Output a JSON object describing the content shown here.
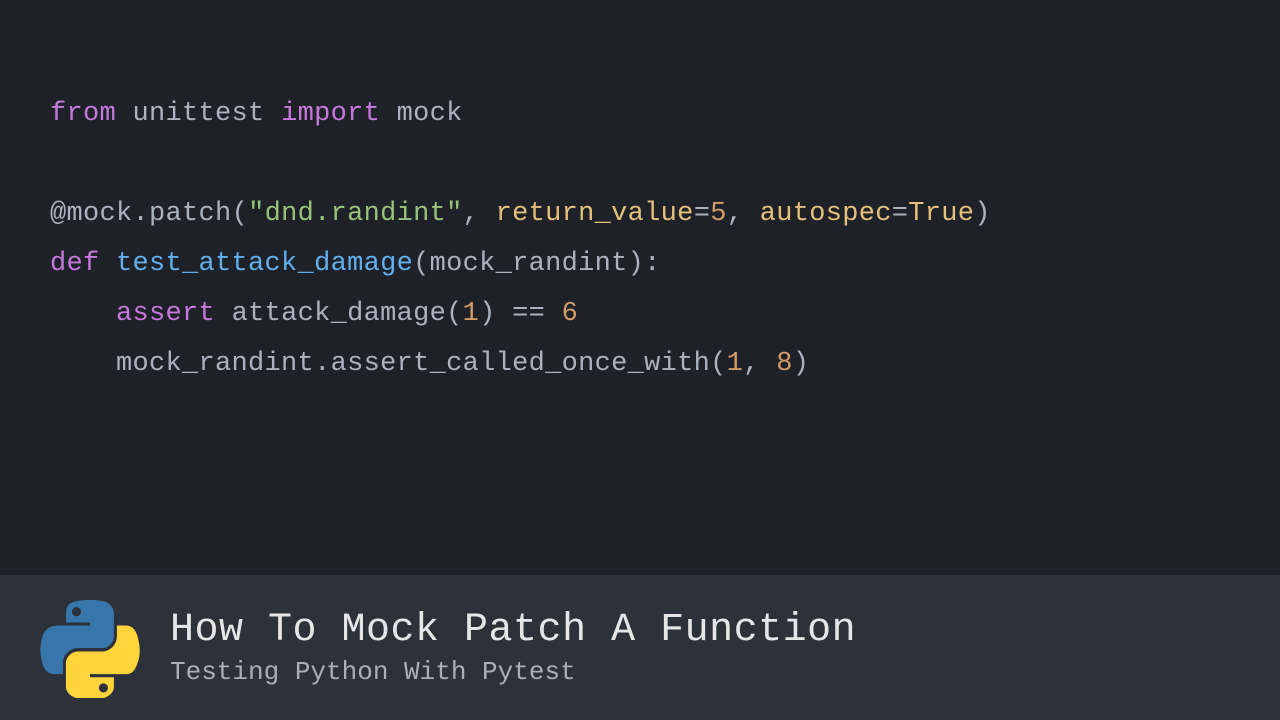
{
  "code": {
    "l1": {
      "kw1": "from",
      "mod": "unittest",
      "kw2": "import",
      "obj": "mock"
    },
    "l2": {
      "at": "@",
      "dec_obj": "mock",
      "dot": ".",
      "dec_fn": "patch",
      "open": "(",
      "str": "\"dnd.randint\"",
      "c1": ", ",
      "p1": "return_value",
      "eq1": "=",
      "v1": "5",
      "c2": ", ",
      "p2": "autospec",
      "eq2": "=",
      "v2": "True",
      "close": ")"
    },
    "l3": {
      "kw": "def",
      "sp": " ",
      "name": "test_attack_damage",
      "open": "(",
      "arg": "mock_randint",
      "close": "):"
    },
    "l4": {
      "indent": "    ",
      "kw": "assert",
      "sp": " ",
      "fn": "attack_damage",
      "open": "(",
      "arg": "1",
      "close": ")",
      "op": " == ",
      "rhs": "6"
    },
    "l5": {
      "indent": "    ",
      "obj": "mock_randint",
      "dot": ".",
      "method": "assert_called_once_with",
      "open": "(",
      "a1": "1",
      "c": ", ",
      "a2": "8",
      "close": ")"
    }
  },
  "footer": {
    "title": "How To Mock Patch A Function",
    "subtitle": "Testing Python With Pytest"
  }
}
